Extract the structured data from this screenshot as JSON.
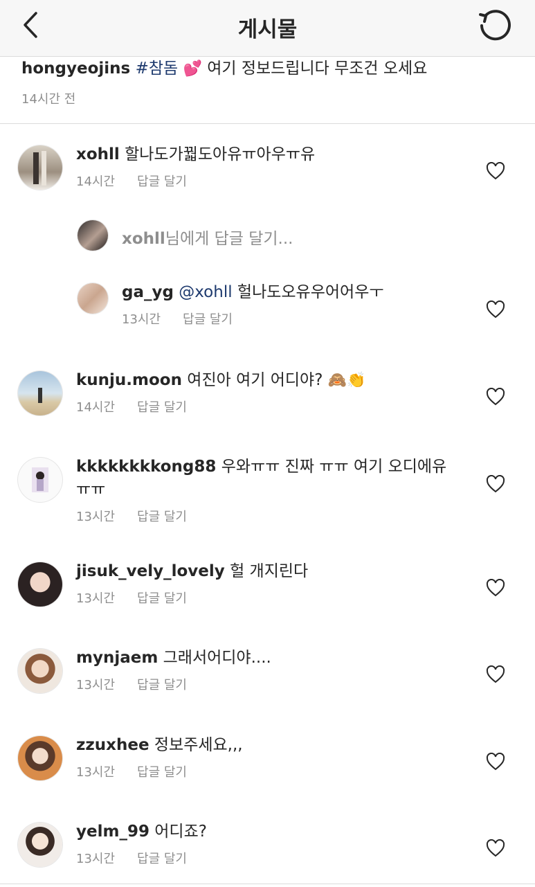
{
  "header": {
    "title": "게시물"
  },
  "caption": {
    "username": "hongyeojins",
    "hashtag": "#참돔",
    "emoji": "💕",
    "text": "여기 정보드립니다 무조건 오세요",
    "time": "14시간 전"
  },
  "reply_box": {
    "username": "xohll",
    "placeholder": "님에게 답글 달기..."
  },
  "comments": [
    {
      "username": "xohll",
      "text": "할나도가꿟도아유ㅠ아우ㅠ유",
      "time": "14시간",
      "reply_label": "답글 달기"
    },
    {
      "username": "ga_yg",
      "mention": "@xohll",
      "text": "헐나도오유우어어우ㅜ",
      "time": "13시간",
      "reply_label": "답글 달기"
    },
    {
      "username": "kunju.moon",
      "text": "여진아 여기 어디야?",
      "emoji": "🙈👏",
      "time": "14시간",
      "reply_label": "답글 달기"
    },
    {
      "username": "kkkkkkkkong88",
      "text": "우와ㅠㅠ 진짜 ㅠㅠ 여기 오디에유 ㅠㅠ",
      "time": "13시간",
      "reply_label": "답글 달기"
    },
    {
      "username": "jisuk_vely_lovely",
      "text": "헐 개지린다",
      "time": "13시간",
      "reply_label": "답글 달기"
    },
    {
      "username": "mynjaem",
      "text": "그래서어디야....",
      "time": "13시간",
      "reply_label": "답글 달기"
    },
    {
      "username": "zzuxhee",
      "text": "정보주세요,,,",
      "time": "13시간",
      "reply_label": "답글 달기"
    },
    {
      "username": "yelm_99",
      "text": "어디죠?",
      "time": "13시간",
      "reply_label": "답글 달기"
    }
  ],
  "colors": {
    "username": "#262626",
    "link": "#1e3a6e",
    "muted": "#8e8e8e",
    "divider": "#dbdbdb",
    "header_bg": "#f7f7f7"
  }
}
